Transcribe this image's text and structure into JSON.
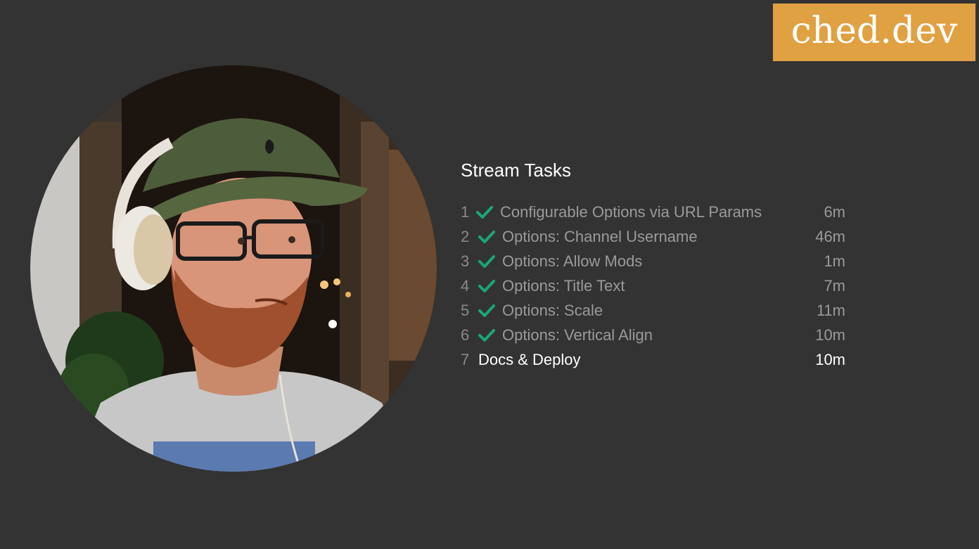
{
  "logo": {
    "text": "ched.dev"
  },
  "colors": {
    "background": "#333333",
    "logo_bg": "#e0a143",
    "check": "#1ca678",
    "done_text": "#9a9a9a",
    "current_text": "#ffffff"
  },
  "webcam": {
    "icon": "webcam-feed"
  },
  "tasks": {
    "title": "Stream Tasks",
    "items": [
      {
        "num": "1",
        "title": "Configurable Options via URL Params",
        "time": "6m",
        "done": true,
        "icon": "check-icon"
      },
      {
        "num": "2",
        "title": "Options: Channel Username",
        "time": "46m",
        "done": true,
        "icon": "check-icon"
      },
      {
        "num": "3",
        "title": "Options: Allow Mods",
        "time": "1m",
        "done": true,
        "icon": "check-icon"
      },
      {
        "num": "4",
        "title": "Options: Title Text",
        "time": "7m",
        "done": true,
        "icon": "check-icon"
      },
      {
        "num": "5",
        "title": "Options: Scale",
        "time": "11m",
        "done": true,
        "icon": "check-icon"
      },
      {
        "num": "6",
        "title": "Options: Vertical Align",
        "time": "10m",
        "done": true,
        "icon": "check-icon"
      },
      {
        "num": "7",
        "title": "Docs & Deploy",
        "time": "10m",
        "done": false,
        "icon": ""
      }
    ]
  }
}
